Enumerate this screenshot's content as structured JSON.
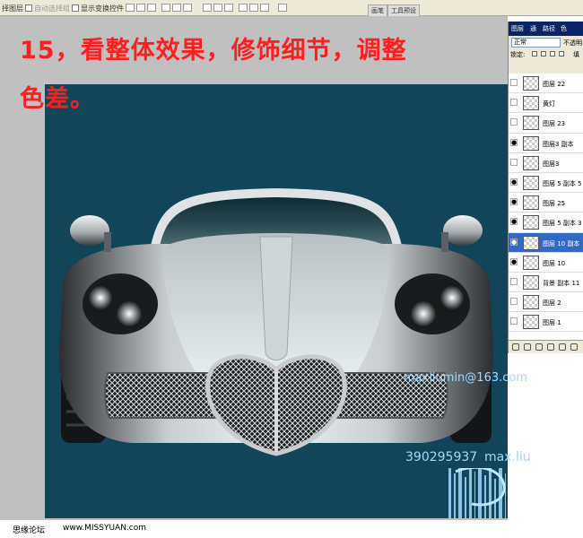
{
  "options_bar": {
    "label_select_layer": "择图层",
    "auto_select": "自动选择组",
    "show_transform": "显示变换控件"
  },
  "tabs": {
    "brushes": "画笔",
    "tool_presets": "工具预设"
  },
  "heading": {
    "line1": "15，看整体效果，修饰细节，调整",
    "line2": "色差。"
  },
  "layers_panel": {
    "tabs": [
      "图层",
      "通",
      "路径",
      "色"
    ],
    "blend_mode": "正常",
    "opacity_label": "不透明",
    "lock_label": "锁定:",
    "fill_label": "填",
    "layers": [
      {
        "name": "图层 22",
        "visible": false,
        "selected": false
      },
      {
        "name": "黄灯",
        "visible": false,
        "selected": false
      },
      {
        "name": "图层 23",
        "visible": false,
        "selected": false
      },
      {
        "name": "图层3 副本",
        "visible": true,
        "selected": false
      },
      {
        "name": "图层3",
        "visible": false,
        "selected": false
      },
      {
        "name": "图层 5 副本 5",
        "visible": true,
        "selected": false
      },
      {
        "name": "图层 25",
        "visible": true,
        "selected": false
      },
      {
        "name": "图层 5 副本 3",
        "visible": true,
        "selected": false
      },
      {
        "name": "图层 10 副本",
        "visible": true,
        "selected": true
      },
      {
        "name": "图层 10",
        "visible": true,
        "selected": false
      },
      {
        "name": "背景 副本 11",
        "visible": false,
        "selected": false
      },
      {
        "name": "图层 2",
        "visible": false,
        "selected": false
      },
      {
        "name": "图层 1",
        "visible": false,
        "selected": false
      }
    ]
  },
  "watermark": {
    "email": "maxliumin@163.com",
    "code": "390295937",
    "name": "max.liu"
  },
  "footer": {
    "site_name": "思缘论坛",
    "site_url": "www.MISSYUAN.com"
  },
  "colors": {
    "canvas_bg": "#12455a",
    "heading": "#ff1e1e",
    "selected_layer": "#316ac5"
  }
}
